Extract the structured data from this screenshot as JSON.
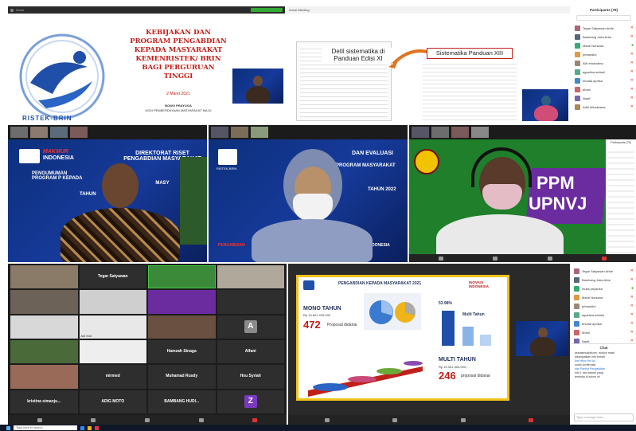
{
  "slide1": {
    "title": "KEBIJAKAN DAN PROGRAM PENGABDIAN KEPADA MASYARAKAT KEMENRISTEK/ BRIN BAGI PERGURUAN TINGGI",
    "date": "2 Maret 2021",
    "presenter": "BOWO PRAYOGA",
    "presenter_title": "ASDI PEMBERDAYAAN MASYARAKAT MAJU",
    "brand": "RISTEK-BRIN"
  },
  "slide2": {
    "window_title": "Zoom Meeting",
    "left_heading": "Detil sistematika di Panduan Edisi XI",
    "right_heading": "Sistematika Panduan XIII"
  },
  "participants_top": {
    "title": "Participants (78)",
    "names": [
      "Tegar Satyawan Arbie",
      "Bambang Jaka Arbe",
      "Mardi Nursana",
      "prihandini",
      "AW ernandesv",
      "agustina setiadi",
      "bhudai aprilsa",
      "dhani",
      "Naafi",
      "Aditi Wicaksana"
    ]
  },
  "cam1": {
    "brand_a": "MAKMUR",
    "brand_b": "INDONESIA",
    "line1": "DIREKTORAT RISET",
    "line2": "PENGABDIAN MASYARAKAT",
    "line3": "PENGUMUMAN",
    "line4": "PROGRAM P KEPADA",
    "line5": "MASY",
    "line6": "TAHUN"
  },
  "cam2": {
    "line1": "DAN EVALUASI",
    "line2": "PROGRAM MASYARAKAT",
    "line3": "TAHUN 2022",
    "line4": "PENGABDIAN",
    "line5": "INDONESIA",
    "brand": "RISTEK-BRIN"
  },
  "cam3": {
    "ppm": "PPM",
    "upnvj": "UPNVJ",
    "panel_title": "Participants (78)"
  },
  "gallery": {
    "tiles": [
      {
        "label": "",
        "name": ""
      },
      {
        "label": "Tegar Satyawan",
        "name": ""
      },
      {
        "label": "",
        "name": ""
      },
      {
        "label": "",
        "name": ""
      },
      {
        "label": "",
        "name": ""
      },
      {
        "label": "",
        "name": ""
      },
      {
        "label": "",
        "name": ""
      },
      {
        "label": "",
        "name": ""
      },
      {
        "label": "",
        "name": ""
      },
      {
        "label": "",
        "name": "Adi Mut"
      },
      {
        "label": "",
        "name": ""
      },
      {
        "label": "",
        "name": ""
      },
      {
        "label": "",
        "name": ""
      },
      {
        "label": "",
        "name": ""
      },
      {
        "label": "Hamzah Sinaga",
        "name": ""
      },
      {
        "label": "Alfani",
        "name": ""
      },
      {
        "label": "",
        "name": ""
      },
      {
        "label": "mirmed",
        "name": ""
      },
      {
        "label": "Muhamad Rusdy",
        "name": ""
      },
      {
        "label": "Hsu Syriah",
        "name": ""
      },
      {
        "label": "kristina simanju...",
        "name": ""
      },
      {
        "label": "ADIG MOTO",
        "name": ""
      },
      {
        "label": "BAMBANG HUDI...",
        "name": ""
      },
      {
        "label": "",
        "name": ""
      }
    ],
    "avatar_a": "A",
    "avatar_z": "Z"
  },
  "infographic": {
    "title": "PENGABDIAN KEPADA MASYARAKAT 2021",
    "brand": "INOVASI INDONESIA",
    "mono_label": "MONO TAHUN",
    "mono_amount": "Rp 19.801.220.000",
    "mono_count": "472",
    "mono_unit": "Proposal didanai",
    "multi_label": "MULTI TAHUN",
    "multi_amount": "Rp 10.331.300.000,-",
    "multi_count": "246",
    "multi_unit": "proposal didanai",
    "multi_chart_title": "Multi Tahun",
    "pct_label": "53.98%"
  },
  "chat": {
    "title": "Chat",
    "lines": [
      "assalamualaikum, mohon maaf",
      "disampaikan info terkait",
      "link https://bit.ly/...",
      "untuk konfirmasi",
      "dari Panitia Pengabdian",
      "info 1 dan aksesi yang",
      "tersedia di kolom ini"
    ],
    "input_placeholder": "Type message here..."
  },
  "participants_bottom": {
    "names": [
      "Tegar Satyawan Arbie",
      "Bambang Jaka Arbe",
      "mulia priyanka",
      "Mardi Nursana",
      "prihandini",
      "agustina setiadi",
      "bhudai aprilsa",
      "dhani",
      "Naafi"
    ]
  },
  "taskbar": {
    "search_placeholder": "Type here to search"
  }
}
